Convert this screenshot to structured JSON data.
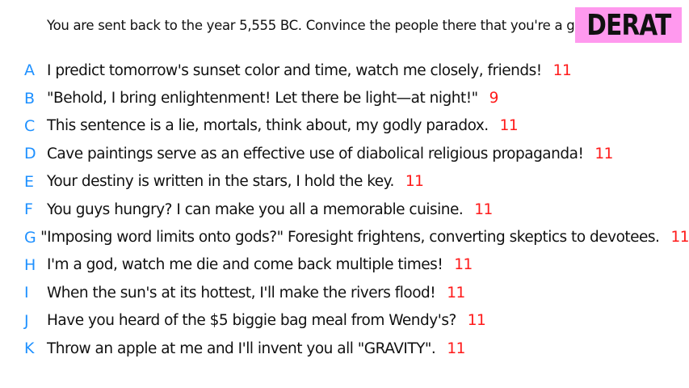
{
  "prompt": "You are sent back to the year 5,555 BC. Convince the people there that you're a god.",
  "badge": {
    "label": "DERAT",
    "color": "#ff99ee"
  },
  "colors": {
    "letter": "#1e90ff",
    "score": "#ff1a1a"
  },
  "answers": [
    {
      "letter": "A",
      "text": "I predict tomorrow's sunset color and time, watch me closely, friends!",
      "score": "11"
    },
    {
      "letter": "B",
      "text": "\"Behold, I bring enlightenment! Let there be light—at night!\"",
      "score": "9"
    },
    {
      "letter": "C",
      "text": "This sentence is a lie, mortals, think about, my godly paradox.",
      "score": "11"
    },
    {
      "letter": "D",
      "text": "Cave paintings serve as an effective use of diabolical religious propaganda!",
      "score": "11"
    },
    {
      "letter": "E",
      "text": "Your destiny is written in the stars, I hold the key.",
      "score": "11"
    },
    {
      "letter": "F",
      "text": "You guys hungry? I can make you all a memorable cuisine.",
      "score": "11"
    },
    {
      "letter": "G",
      "text": "\"Imposing word limits onto gods?\" Foresight frightens, converting skeptics to devotees.",
      "score": "11"
    },
    {
      "letter": "H",
      "text": "I'm a god, watch me die and come back multiple times!",
      "score": "11"
    },
    {
      "letter": "I",
      "text": "When the sun's at its hottest, I'll make the rivers flood!",
      "score": "11"
    },
    {
      "letter": "J",
      "text": "Have you heard of the $5 biggie bag meal from Wendy's?",
      "score": "11"
    },
    {
      "letter": "K",
      "text": "Throw an apple at me and I'll invent you all \"GRAVITY\".",
      "score": "11"
    }
  ]
}
